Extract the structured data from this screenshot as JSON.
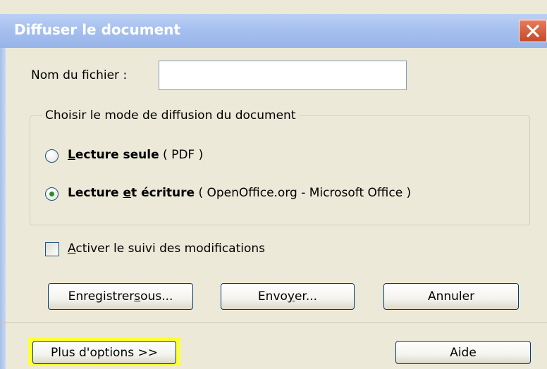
{
  "window": {
    "title": "Diffuser le document"
  },
  "filename": {
    "label": "Nom du fichier :",
    "value": "",
    "placeholder": ""
  },
  "mode_group": {
    "legend": "Choisir le mode de diffusion du document",
    "options": [
      {
        "u": "L",
        "bold_rest": "ecture seule",
        "detail": " ( PDF )",
        "selected": false
      },
      {
        "pre": "Lecture ",
        "u": "e",
        "bold_rest": "t écriture",
        "detail": " ( OpenOffice.org - Microsoft Office )",
        "selected": true
      }
    ]
  },
  "track_changes": {
    "u": "A",
    "rest": "ctiver le suivi des modifications",
    "checked": false
  },
  "buttons": {
    "save_as": {
      "pre": "Enregistrer ",
      "u": "s",
      "post": "ous..."
    },
    "send": {
      "pre": "Envo",
      "u": "y",
      "post": "er..."
    },
    "cancel": "Annuler",
    "more_options": "Plus d'options >>",
    "help": "Aide"
  },
  "colors": {
    "titlebar": "#a6c0ef",
    "dialog_bg": "#ece9d8",
    "highlight": "#ffff33",
    "radio_selected": "#2b8a2e"
  }
}
